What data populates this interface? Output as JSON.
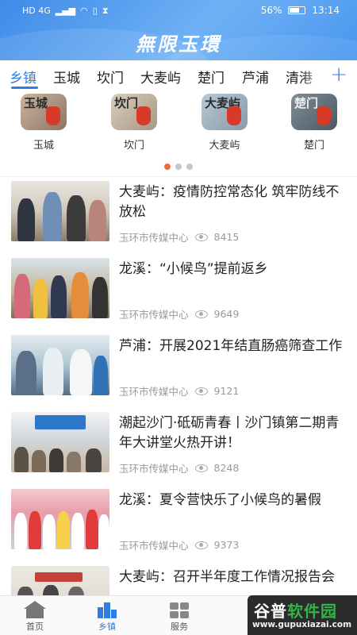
{
  "status_bar": {
    "carrier": "HD 4G",
    "battery": "56%",
    "time": "13:14"
  },
  "header": {
    "title": "無限玉環"
  },
  "tabs": {
    "items": [
      "乡镇",
      "玉城",
      "坎门",
      "大麦屿",
      "楚门",
      "芦浦",
      "清港"
    ],
    "active": "乡镇",
    "add_icon": "plus-icon"
  },
  "towns": [
    {
      "label": "玉城",
      "thumb_text": "玉城"
    },
    {
      "label": "坎门",
      "thumb_text": "坎门"
    },
    {
      "label": "大麦屿",
      "thumb_text": "大麦屿"
    },
    {
      "label": "楚门",
      "thumb_text": "楚门"
    }
  ],
  "carousel": {
    "pages": 3,
    "current": 1
  },
  "news": [
    {
      "title": "大麦屿：疫情防控常态化 筑牢防线不放松",
      "source": "玉环市传媒中心",
      "views": "8415"
    },
    {
      "title": "龙溪：“小候鸟”提前返乡",
      "source": "玉环市传媒中心",
      "views": "9649"
    },
    {
      "title": "芦浦：开展2021年结直肠癌筛查工作",
      "source": "玉环市传媒中心",
      "views": "9121"
    },
    {
      "title": "潮起沙门·砥砺青春丨沙门镇第二期青年大讲堂火热开讲！",
      "source": "玉环市传媒中心",
      "views": "8248"
    },
    {
      "title": "龙溪：夏令营快乐了小候鸟的暑假",
      "source": "玉环市传媒中心",
      "views": "9373"
    },
    {
      "title": "大麦屿：召开半年度工作情况报告会",
      "source": "",
      "views": ""
    }
  ],
  "bottom_nav": [
    {
      "label": "首页",
      "icon": "home-icon"
    },
    {
      "label": "乡镇",
      "icon": "town-icon",
      "active": true
    },
    {
      "label": "服务",
      "icon": "grid-icon"
    }
  ],
  "watermark": {
    "main_a": "谷普",
    "main_b": "软件园",
    "url": "www.gupuxiazai.com"
  },
  "colors": {
    "accent": "#2f7de1",
    "header": "#4a97ee",
    "dot_active": "#ef6a3a"
  }
}
